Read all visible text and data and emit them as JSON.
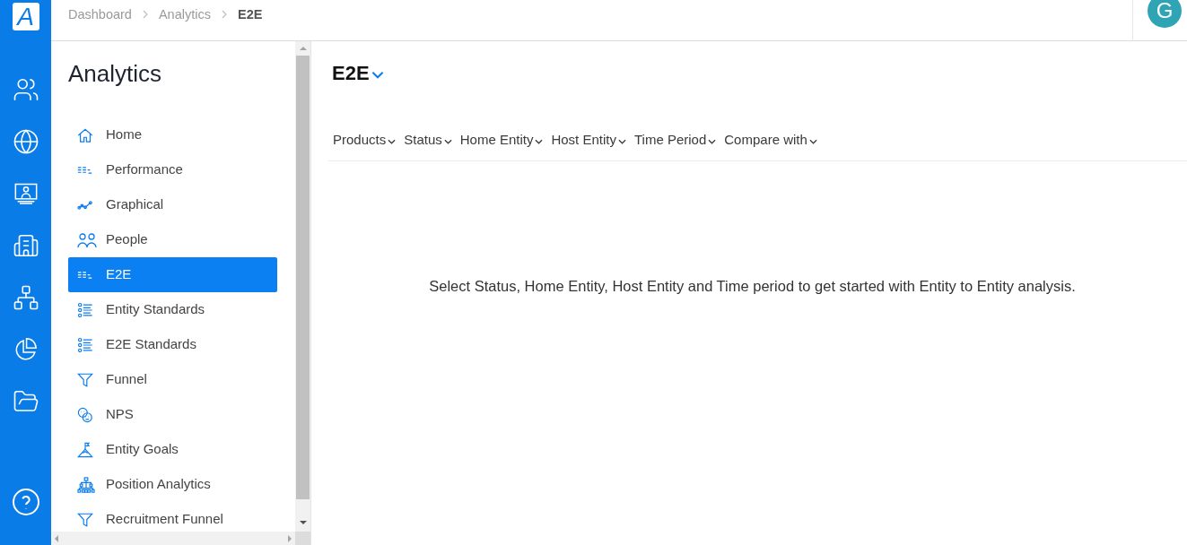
{
  "brand": {
    "logo_letter": "A"
  },
  "breadcrumb": [
    {
      "label": "Dashboard",
      "current": false
    },
    {
      "label": "Analytics",
      "current": false
    },
    {
      "label": "E2E",
      "current": true
    }
  ],
  "user": {
    "initial": "G"
  },
  "sidebar": {
    "title": "Analytics",
    "items": [
      {
        "label": "Home",
        "kind": "home",
        "selected": false
      },
      {
        "label": "Performance",
        "kind": "lines",
        "selected": false
      },
      {
        "label": "Graphical",
        "kind": "graph",
        "selected": false
      },
      {
        "label": "People",
        "kind": "people",
        "selected": false
      },
      {
        "label": "E2E",
        "kind": "lines",
        "selected": true
      },
      {
        "label": "Entity Standards",
        "kind": "checklist",
        "selected": false
      },
      {
        "label": "E2E Standards",
        "kind": "checklist",
        "selected": false
      },
      {
        "label": "Funnel",
        "kind": "funnel",
        "selected": false
      },
      {
        "label": "NPS",
        "kind": "faces",
        "selected": false
      },
      {
        "label": "Entity Goals",
        "kind": "goal",
        "selected": false
      },
      {
        "label": "Position Analytics",
        "kind": "tree",
        "selected": false
      },
      {
        "label": "Recruitment Funnel",
        "kind": "funnel",
        "selected": false
      }
    ]
  },
  "page": {
    "title": "E2E",
    "filters": [
      "Products",
      "Status",
      "Home Entity",
      "Host Entity",
      "Time Period",
      "Compare with"
    ],
    "message": "Select Status, Home Entity, Host Entity and Time period to get started with Entity to Entity analysis."
  }
}
